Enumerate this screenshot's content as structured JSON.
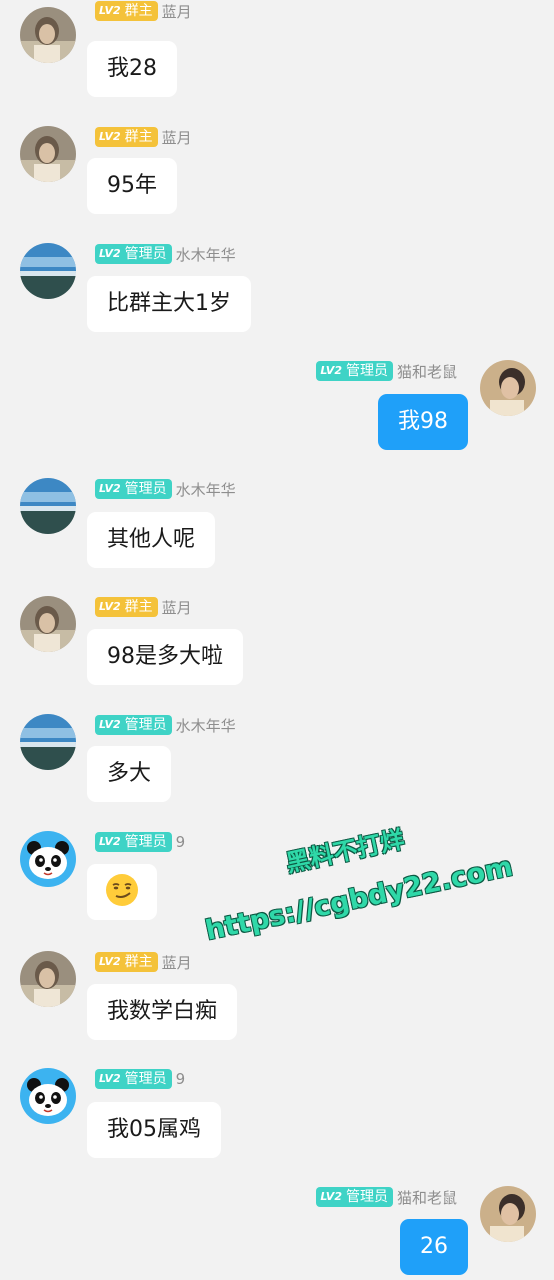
{
  "colors": {
    "background": "#f2f2f2",
    "incoming_bubble": "#ffffff",
    "outgoing_bubble": "#1fa0f9",
    "owner_badge": "#f4c23a",
    "admin_badge": "#3fd3c6",
    "nickname": "#8e8e8e",
    "watermark": "#2fd8a8"
  },
  "badges": {
    "level": "LV2",
    "owner": "群主",
    "admin": "管理员"
  },
  "messages": [
    {
      "side": "left",
      "avatar": "girl-photo-avatar",
      "role": "owner",
      "nickname": "蓝月",
      "text": "我28"
    },
    {
      "side": "left",
      "avatar": "girl-photo-avatar",
      "role": "owner",
      "nickname": "蓝月",
      "text": "95年"
    },
    {
      "side": "left",
      "avatar": "sky-landscape-avatar",
      "role": "admin",
      "nickname": "水木年华",
      "text": "比群主大1岁"
    },
    {
      "side": "right",
      "avatar": "person-photo-avatar",
      "role": "admin",
      "nickname": "猫和老鼠",
      "text": "我98"
    },
    {
      "side": "left",
      "avatar": "sky-landscape-avatar",
      "role": "admin",
      "nickname": "水木年华",
      "text": "其他人呢"
    },
    {
      "side": "left",
      "avatar": "girl-photo-avatar",
      "role": "owner",
      "nickname": "蓝月",
      "text": "98是多大啦"
    },
    {
      "side": "left",
      "avatar": "sky-landscape-avatar",
      "role": "admin",
      "nickname": "水木年华",
      "text": "多大"
    },
    {
      "side": "left",
      "avatar": "panda-avatar",
      "role": "admin",
      "nickname": "9",
      "text": "",
      "emoji": "smirk-emoji"
    },
    {
      "side": "left",
      "avatar": "girl-photo-avatar",
      "role": "owner",
      "nickname": "蓝月",
      "text": "我数学白痴"
    },
    {
      "side": "left",
      "avatar": "panda-avatar",
      "role": "admin",
      "nickname": "9",
      "text": "我05属鸡"
    },
    {
      "side": "right",
      "avatar": "person-photo-avatar",
      "role": "admin",
      "nickname": "猫和老鼠",
      "text": "26"
    }
  ],
  "watermark": {
    "line1": "黑料不打烊",
    "line2": "https://cgbdy22.com"
  }
}
